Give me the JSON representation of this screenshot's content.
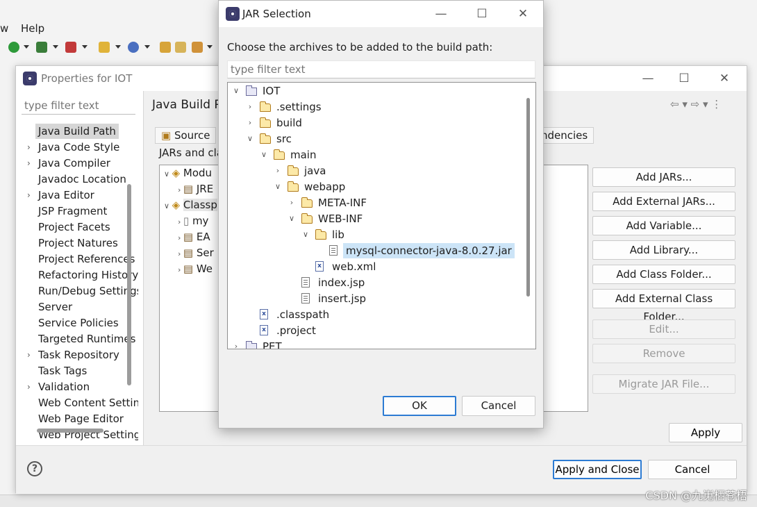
{
  "eclipse": {
    "menu": {
      "window_partial": "w",
      "help": "Help"
    },
    "watermark": "CSDN @九嵬栖苍梧"
  },
  "properties_dialog": {
    "title": "Properties for IOT",
    "filter_placeholder": "type filter text",
    "nav_items": [
      {
        "label": "Java Build Path",
        "selected": true,
        "expandable": false
      },
      {
        "label": "Java Code Style",
        "expandable": true
      },
      {
        "label": "Java Compiler",
        "expandable": true
      },
      {
        "label": "Javadoc Location",
        "expandable": false
      },
      {
        "label": "Java Editor",
        "expandable": true
      },
      {
        "label": "JSP Fragment",
        "expandable": false
      },
      {
        "label": "Project Facets",
        "expandable": false
      },
      {
        "label": "Project Natures",
        "expandable": false
      },
      {
        "label": "Project References",
        "expandable": false
      },
      {
        "label": "Refactoring History",
        "expandable": false
      },
      {
        "label": "Run/Debug Settings",
        "expandable": false
      },
      {
        "label": "Server",
        "expandable": false
      },
      {
        "label": "Service Policies",
        "expandable": false
      },
      {
        "label": "Targeted Runtimes",
        "expandable": false
      },
      {
        "label": "Task Repository",
        "expandable": true
      },
      {
        "label": "Task Tags",
        "expandable": false
      },
      {
        "label": "Validation",
        "expandable": true
      },
      {
        "label": "Web Content Settings",
        "expandable": false
      },
      {
        "label": "Web Page Editor",
        "expandable": false
      },
      {
        "label": "Web Project Settings",
        "expandable": false
      }
    ],
    "page_header": "Java Build Path",
    "tabs": {
      "source": "Source",
      "dependencies_partial": "ndencies"
    },
    "jars_label": "JARs and cla",
    "bg_tree": [
      {
        "label": "Modu"
      },
      {
        "label": "JRE"
      },
      {
        "label": "Classp"
      },
      {
        "label": "my"
      },
      {
        "label": "EA"
      },
      {
        "label": "Ser"
      },
      {
        "label": "We"
      }
    ],
    "side_buttons": {
      "add_jars": "Add JARs...",
      "add_external_jars": "Add External JARs...",
      "add_variable": "Add Variable...",
      "add_library": "Add Library...",
      "add_class_folder": "Add Class Folder...",
      "add_external_class_folder": "Add External Class Folder...",
      "edit": "Edit...",
      "remove": "Remove",
      "migrate": "Migrate JAR File..."
    },
    "apply": "Apply",
    "apply_and_close": "Apply and Close",
    "cancel": "Cancel",
    "help_glyph": "?"
  },
  "jar_dialog": {
    "title": "JAR Selection",
    "prompt": "Choose the archives to be added to the build path:",
    "filter_placeholder": "type filter text",
    "tree": [
      {
        "label": "IOT",
        "icon": "project",
        "depth": 0,
        "chevron": "down"
      },
      {
        "label": ".settings",
        "icon": "folder",
        "depth": 1,
        "chevron": "right"
      },
      {
        "label": "build",
        "icon": "folder",
        "depth": 1,
        "chevron": "right"
      },
      {
        "label": "src",
        "icon": "folder",
        "depth": 1,
        "chevron": "down"
      },
      {
        "label": "main",
        "icon": "folder",
        "depth": 2,
        "chevron": "down"
      },
      {
        "label": "java",
        "icon": "folder",
        "depth": 3,
        "chevron": "right"
      },
      {
        "label": "webapp",
        "icon": "folder",
        "depth": 3,
        "chevron": "down"
      },
      {
        "label": "META-INF",
        "icon": "folder",
        "depth": 4,
        "chevron": "right"
      },
      {
        "label": "WEB-INF",
        "icon": "folder",
        "depth": 4,
        "chevron": "down"
      },
      {
        "label": "lib",
        "icon": "folder",
        "depth": 5,
        "chevron": "down"
      },
      {
        "label": "mysql-connector-java-8.0.27.jar",
        "icon": "jar",
        "depth": 6,
        "chevron": "",
        "selected": true
      },
      {
        "label": "web.xml",
        "icon": "xml",
        "depth": 5,
        "chevron": ""
      },
      {
        "label": "index.jsp",
        "icon": "file",
        "depth": 4,
        "chevron": ""
      },
      {
        "label": "insert.jsp",
        "icon": "file",
        "depth": 4,
        "chevron": ""
      },
      {
        "label": ".classpath",
        "icon": "xml",
        "depth": 1,
        "chevron": ""
      },
      {
        "label": ".project",
        "icon": "xml",
        "depth": 1,
        "chevron": ""
      },
      {
        "label": "PET",
        "icon": "project",
        "depth": 0,
        "chevron": "right"
      }
    ],
    "ok": "OK",
    "cancel": "Cancel"
  }
}
